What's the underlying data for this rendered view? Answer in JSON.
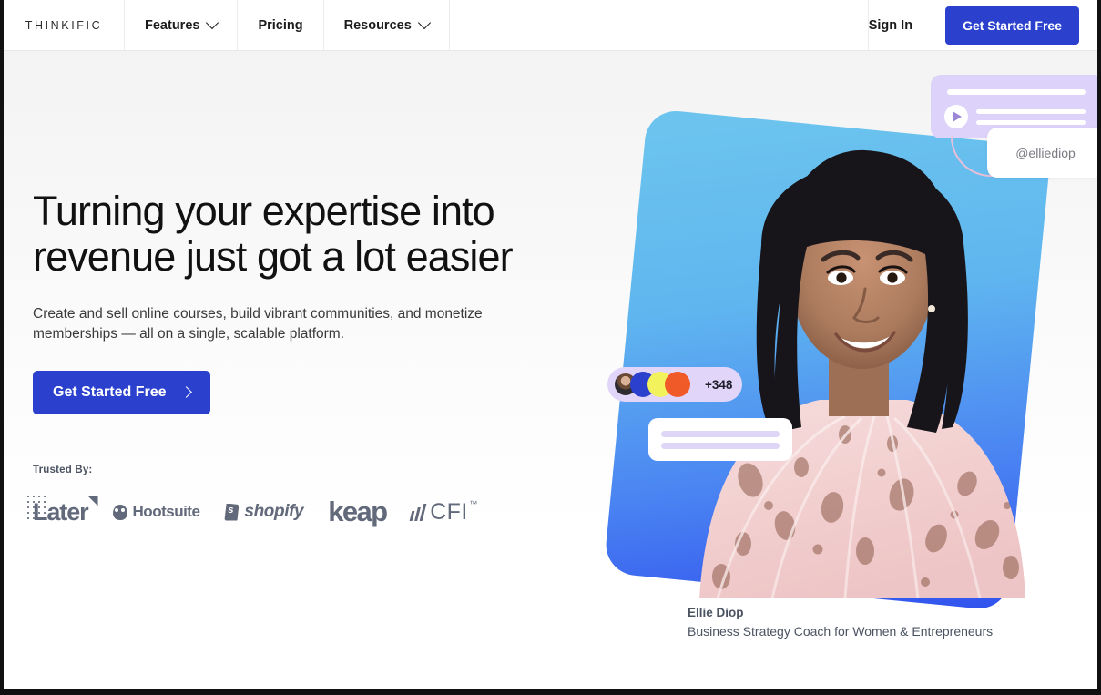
{
  "nav": {
    "brand": "THINKIFIC",
    "items": [
      {
        "label": "Features",
        "has_chevron": true
      },
      {
        "label": "Pricing",
        "has_chevron": false
      },
      {
        "label": "Resources",
        "has_chevron": true
      }
    ],
    "signin_label": "Sign In",
    "cta_label": "Get Started Free",
    "cta_color": "#2b41ce"
  },
  "hero": {
    "headline_line1": "Turning your expertise into",
    "headline_line2": "revenue just got a lot easier",
    "subhead_line1": "Create and sell online courses, build vibrant communities, and monetize",
    "subhead_line2": "memberships — all on a single, scalable platform.",
    "cta_label": "Get Started Free",
    "cta_arrow": "chevron-right-icon"
  },
  "trusted": {
    "label": "Trusted By:",
    "logos": [
      {
        "name": "Later"
      },
      {
        "name": "Hootsuite"
      },
      {
        "name": "shopify"
      },
      {
        "name": "keap"
      },
      {
        "name": "CFI",
        "trademark": "™"
      }
    ]
  },
  "visual": {
    "card_gradient_from": "#6dc5ee",
    "card_gradient_to": "#3152ee",
    "media_card_color": "#ddd2fa",
    "play_icon": "play-icon",
    "handle": "@elliediop",
    "avatar_count": "+348",
    "avatar_colors": [
      "#2b41ce",
      "#f2f25c",
      "#f05a28"
    ],
    "caption_name": "Ellie Diop",
    "caption_role": "Business Strategy Coach for Women & Entrepreneurs"
  }
}
